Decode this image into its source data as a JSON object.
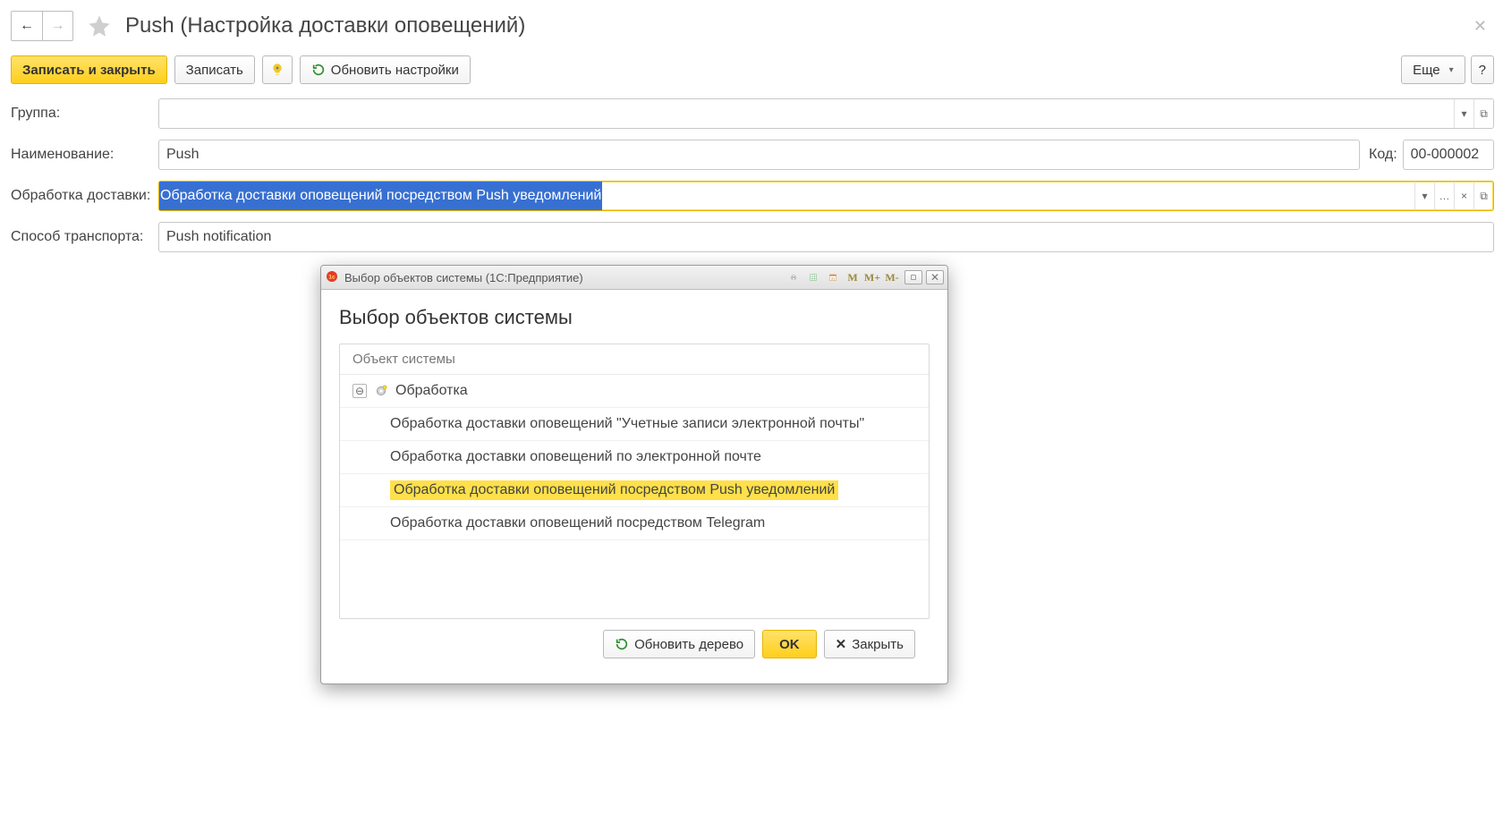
{
  "header": {
    "title": "Push (Настройка доставки оповещений)"
  },
  "toolbar": {
    "save_close": "Записать и закрыть",
    "save": "Записать",
    "refresh_settings": "Обновить настройки",
    "more": "Еще",
    "help": "?"
  },
  "form": {
    "group_label": "Группа:",
    "group_value": "",
    "name_label": "Наименование:",
    "name_value": "Push",
    "code_label": "Код:",
    "code_value": "00-000002",
    "handler_label": "Обработка доставки:",
    "handler_value": "Обработка доставки оповещений посредством Push уведомлений",
    "transport_label": "Способ транспорта:",
    "transport_value": "Push notification"
  },
  "dialog": {
    "titlebar_text": "Выбор объектов системы  (1С:Предприятие)",
    "heading": "Выбор объектов системы",
    "column_header": "Объект системы",
    "tree": {
      "parent": "Обработка",
      "children": [
        "Обработка доставки оповещений \"Учетные записи электронной почты\"",
        "Обработка доставки оповещений по электронной почте",
        "Обработка доставки оповещений посредством Push уведомлений",
        "Обработка доставки оповещений посредством Telegram"
      ],
      "selected_index": 2
    },
    "toolbar_buttons": {
      "m": "M",
      "m_plus": "M+",
      "m_minus": "M-"
    },
    "close_symbol": "✕",
    "footer": {
      "refresh_tree": "Обновить дерево",
      "ok": "OK",
      "close": "Закрыть"
    }
  },
  "icons": {
    "back": "←",
    "forward": "→",
    "dropdown": "▾",
    "ellipsis": "…",
    "clear": "×",
    "open": "⧉",
    "minus": "⊖"
  }
}
